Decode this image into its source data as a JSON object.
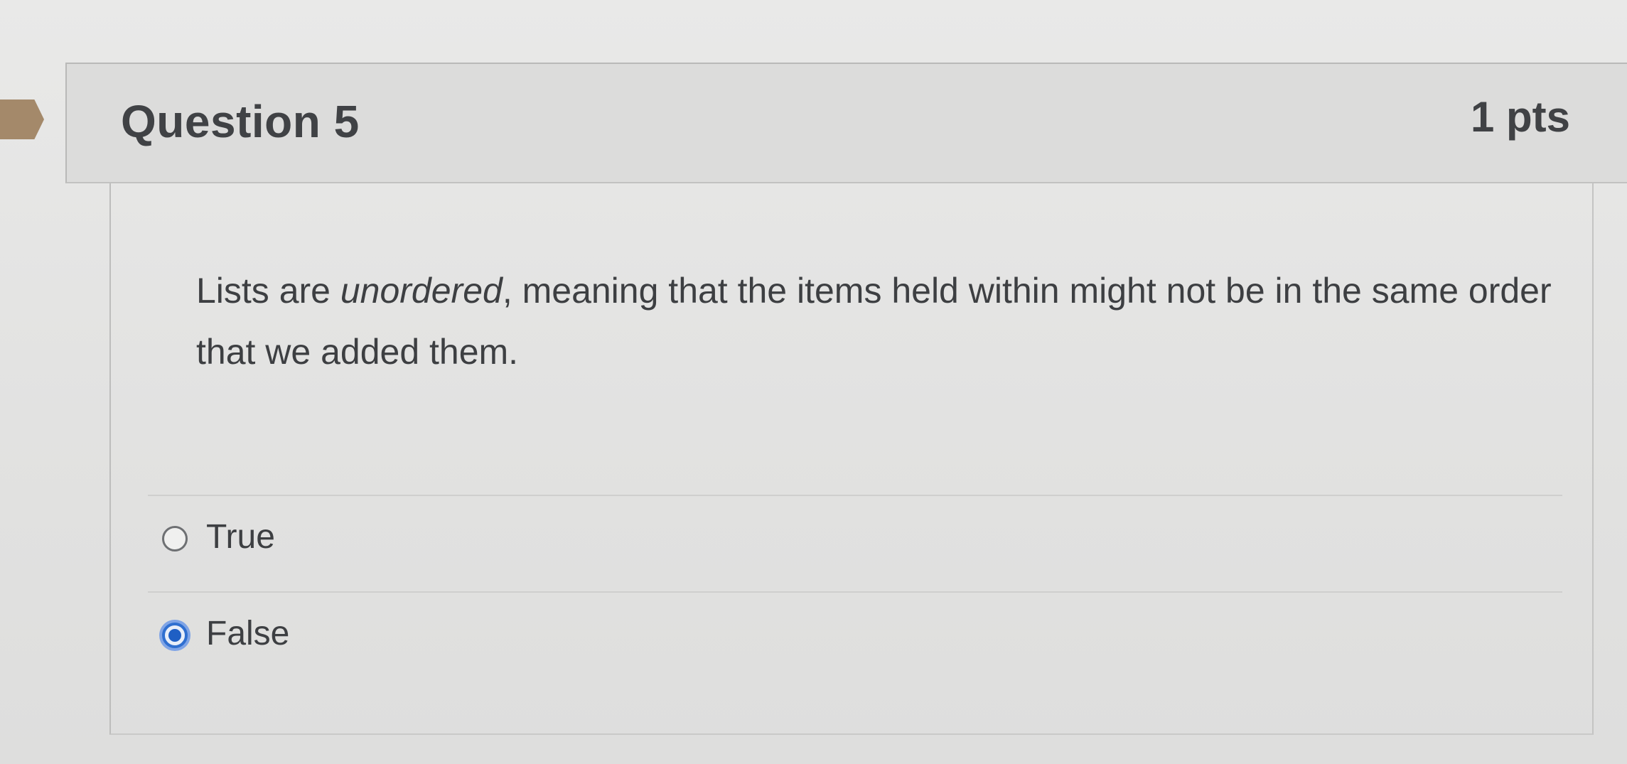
{
  "question": {
    "title": "Question 5",
    "points": "1 pts",
    "text_before": "Lists are ",
    "text_emphasis": "unordered",
    "text_after": ", meaning that the items held within might not be in the same order that we added them."
  },
  "answers": [
    {
      "label": "True",
      "selected": false
    },
    {
      "label": "False",
      "selected": true
    }
  ],
  "colors": {
    "marker": "#a4896a",
    "header_bg": "#dcdcdb",
    "selected_radio": "#2f6fd0",
    "text": "#3d3f42"
  },
  "icons": {
    "marker": "question-marker-flag-icon",
    "radio_unchecked": "radio-unchecked-icon",
    "radio_checked": "radio-checked-icon"
  }
}
